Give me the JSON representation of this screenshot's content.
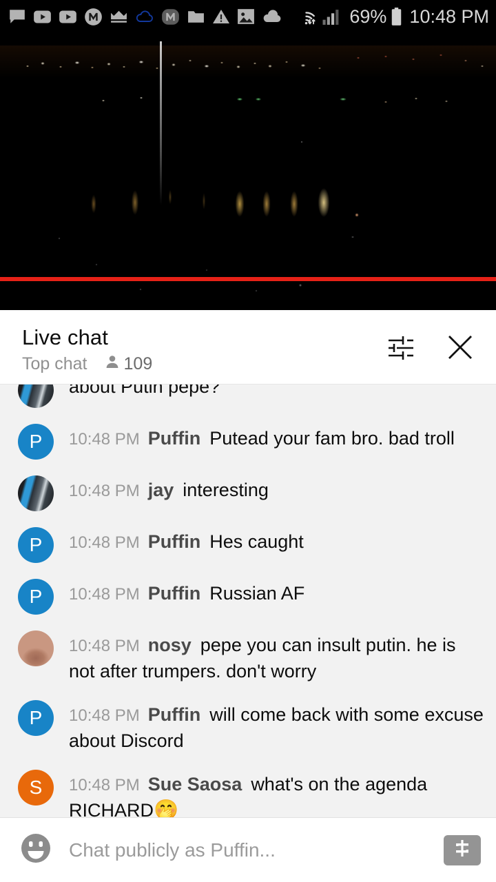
{
  "statusbar": {
    "icons": [
      "chat-bubble-icon",
      "youtube-play-icon",
      "youtube-play-icon",
      "m-circle-icon",
      "crown-icon",
      "cloud-outline-icon",
      "m-badge-icon",
      "folder-icon",
      "warning-triangle-icon",
      "image-icon",
      "cloud-filled-icon"
    ],
    "wifi_icon": "wifi-data-icon",
    "signal_icon": "cellular-signal-icon",
    "battery_percent": "69%",
    "battery_icon": "battery-icon",
    "time": "10:48 PM"
  },
  "video": {
    "progress_color": "#e62117",
    "description": "night cityscape live stream"
  },
  "chat_header": {
    "title": "Live chat",
    "subtitle": "Top chat",
    "viewer_icon": "person-icon",
    "viewer_count": "109",
    "tune_icon": "tune-sliders-icon",
    "close_icon": "close-icon"
  },
  "messages": [
    {
      "avatar_type": "photo-jay",
      "avatar_letter": "",
      "time": "",
      "author": "",
      "text": "about Putin pepe?",
      "clipped": true
    },
    {
      "avatar_type": "letter",
      "avatar_letter": "P",
      "avatar_color": "#1884c7",
      "time": "10:48 PM",
      "author": "Puffin",
      "text": "Putead your fam bro. bad troll"
    },
    {
      "avatar_type": "photo-jay",
      "avatar_letter": "",
      "time": "10:48 PM",
      "author": "jay",
      "text": "interesting"
    },
    {
      "avatar_type": "letter",
      "avatar_letter": "P",
      "avatar_color": "#1884c7",
      "time": "10:48 PM",
      "author": "Puffin",
      "text": "Hes caught"
    },
    {
      "avatar_type": "letter",
      "avatar_letter": "P",
      "avatar_color": "#1884c7",
      "time": "10:48 PM",
      "author": "Puffin",
      "text": "Russian AF"
    },
    {
      "avatar_type": "photo-nosy",
      "avatar_letter": "",
      "time": "10:48 PM",
      "author": "nosy",
      "text": "pepe you can insult putin. he is not after trumpers. don't worry"
    },
    {
      "avatar_type": "letter",
      "avatar_letter": "P",
      "avatar_color": "#1884c7",
      "time": "10:48 PM",
      "author": "Puffin",
      "text": "will come back with some excuse about Discord"
    },
    {
      "avatar_type": "letter",
      "avatar_letter": "S",
      "avatar_color": "#e8690b",
      "time": "10:48 PM",
      "author": "Sue Saosa",
      "text": "what's on the agenda RICHARD",
      "emoji": "🤭"
    }
  ],
  "composer": {
    "emoji_icon": "emoji-face-icon",
    "placeholder": "Chat publicly as Puffin...",
    "superchat_icon": "dollar-sign-icon"
  }
}
